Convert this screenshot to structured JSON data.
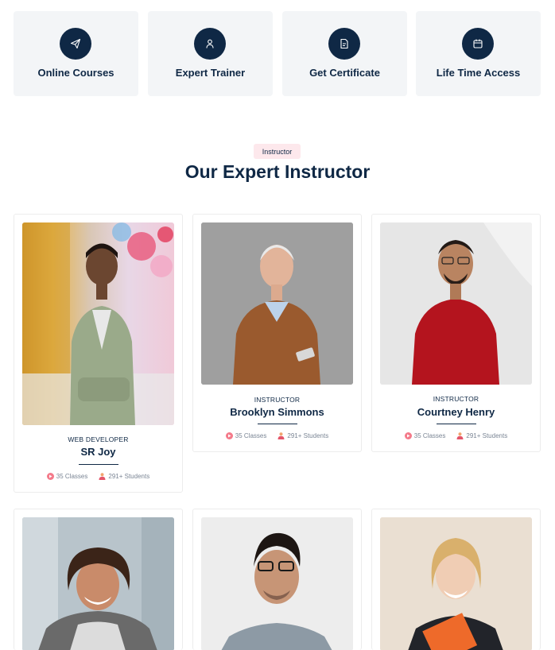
{
  "features": [
    {
      "label": "Online Courses",
      "icon": "paper-plane-icon"
    },
    {
      "label": "Expert Trainer",
      "icon": "user-icon"
    },
    {
      "label": "Get Certificate",
      "icon": "document-icon"
    },
    {
      "label": "Life Time Access",
      "icon": "calendar-icon"
    }
  ],
  "section": {
    "badge": "Instructor",
    "title": "Our Expert Instructor"
  },
  "instructors": [
    {
      "role": "WEB DEVELOPER",
      "name": "SR Joy",
      "classes": "35 Classes",
      "students": "291+ Students"
    },
    {
      "role": "INSTRUCTOR",
      "name": "Brooklyn Simmons",
      "classes": "35 Classes",
      "students": "291+ Students"
    },
    {
      "role": "INSTRUCTOR",
      "name": "Courtney Henry",
      "classes": "35 Classes",
      "students": "291+ Students"
    }
  ],
  "colors": {
    "navy": "#0f2845",
    "feature_bg": "#f3f5f7",
    "badge_bg": "#fde8ec",
    "accent": "#f47a8a"
  }
}
